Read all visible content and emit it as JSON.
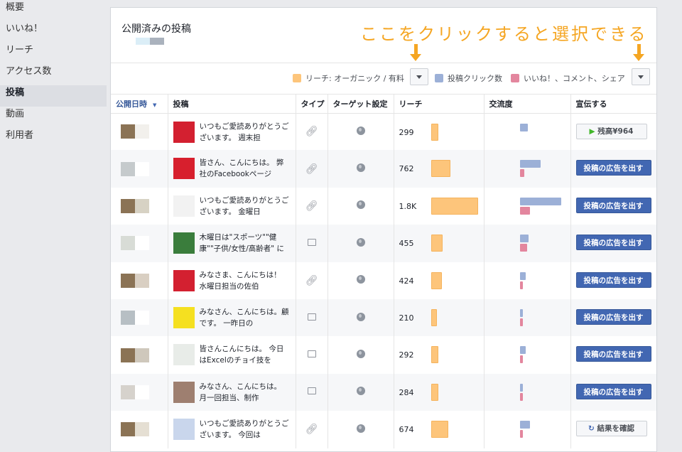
{
  "sidebar": {
    "items": [
      "概要",
      "いいね！",
      "リーチ",
      "アクセス数",
      "投稿",
      "動画",
      "利用者"
    ],
    "active_index": 4
  },
  "panel": {
    "title": "公開済みの投稿"
  },
  "annotation": "ここをクリックすると選択できる",
  "legend": {
    "reach": "リーチ: オーガニック / 有料",
    "clicks": "投稿クリック数",
    "reactions": "いいね！、コメント、シェア"
  },
  "colors": {
    "reach": "#fdc57b",
    "clicks": "#9cb0d7",
    "reactions": "#e3869e",
    "accent": "#f5a623",
    "boost": "#4267b2"
  },
  "table": {
    "headers": [
      "公開日時",
      "投稿",
      "タイプ",
      "ターゲット設定",
      "リーチ",
      "交流度",
      "宣伝する"
    ],
    "rows": [
      {
        "text": "いつもご愛読ありがとうございます。 週末担",
        "type": "link",
        "reach": "299",
        "reach_n": 299,
        "clicks": 0.2,
        "reactions": 0,
        "action": "残高¥964",
        "action_kind": "balance"
      },
      {
        "text": "皆さん、こんにちは。 弊社のFacebookページ",
        "type": "link",
        "reach": "762",
        "reach_n": 762,
        "clicks": 0.5,
        "reactions": 0.12,
        "action": "投稿の広告を出す",
        "action_kind": "boost"
      },
      {
        "text": "いつもご愛読ありがとうございます。 金曜日",
        "type": "link",
        "reach": "1.8K",
        "reach_n": 1800,
        "clicks": 1.0,
        "reactions": 0.25,
        "action": "投稿の広告を出す",
        "action_kind": "boost"
      },
      {
        "text": "木曜日は\"スポーツ\"\"健康\"\"子供/女性/高齢者\" に",
        "type": "album",
        "reach": "455",
        "reach_n": 455,
        "clicks": 0.22,
        "reactions": 0.18,
        "action": "投稿の広告を出す",
        "action_kind": "boost"
      },
      {
        "text": "みなさま、こんにちは！ 水曜日担当の佐伯",
        "type": "link",
        "reach": "424",
        "reach_n": 424,
        "clicks": 0.14,
        "reactions": 0.06,
        "action": "投稿の広告を出す",
        "action_kind": "boost"
      },
      {
        "text": "みなさん、こんにちは。顧です。 一昨日の",
        "type": "album",
        "reach": "210",
        "reach_n": 210,
        "clicks": 0.06,
        "reactions": 0.06,
        "action": "投稿の広告を出す",
        "action_kind": "boost"
      },
      {
        "text": "皆さんこんにちは。 今日はExcelのチョイ技を",
        "type": "album",
        "reach": "292",
        "reach_n": 292,
        "clicks": 0.14,
        "reactions": 0.08,
        "action": "投稿の広告を出す",
        "action_kind": "boost"
      },
      {
        "text": "みなさん、こんにちは。 月一回担当、制作",
        "type": "album",
        "reach": "284",
        "reach_n": 284,
        "clicks": 0.08,
        "reactions": 0.06,
        "action": "投稿の広告を出す",
        "action_kind": "boost"
      },
      {
        "text": "いつもご愛読ありがとうございます。 今回は",
        "type": "link",
        "reach": "674",
        "reach_n": 674,
        "clicks": 0.25,
        "reactions": 0.08,
        "action": "結果を確認",
        "action_kind": "results"
      }
    ]
  }
}
